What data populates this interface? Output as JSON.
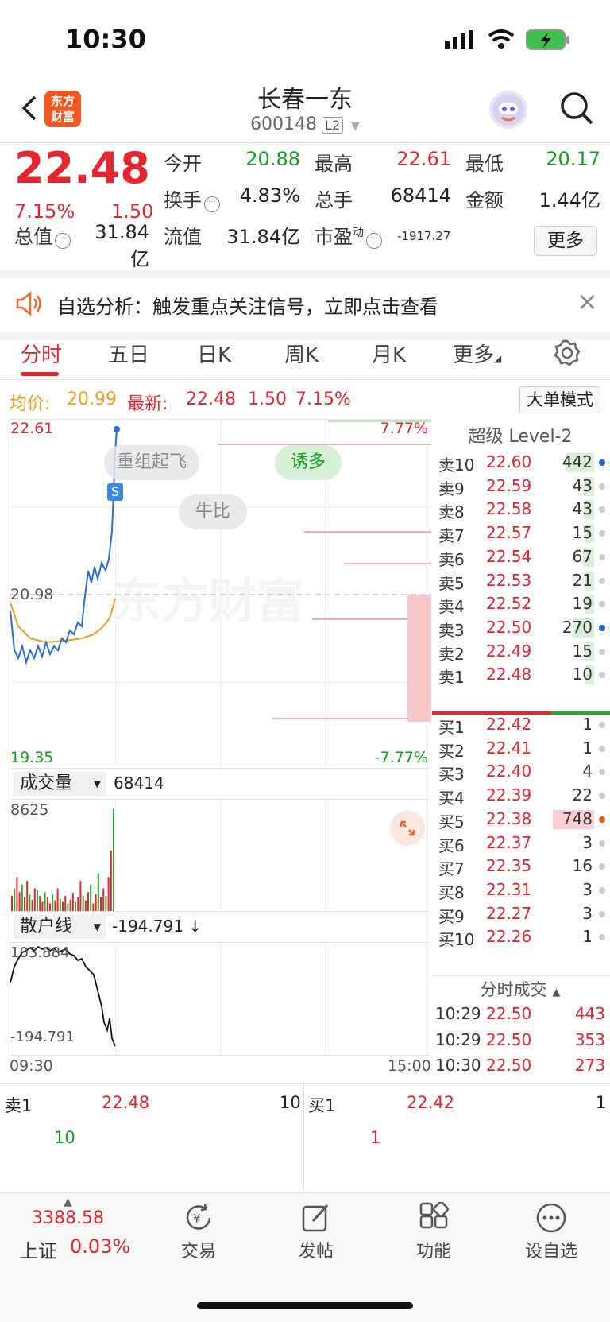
{
  "status": {
    "time": "10:30"
  },
  "header": {
    "title": "长春一东",
    "code": "600148",
    "level": "L2",
    "logo_line1": "东方",
    "logo_line2": "财富"
  },
  "quote": {
    "price": "22.48",
    "pct": "7.15%",
    "change": "1.50",
    "fields": [
      {
        "label": "今开",
        "value": "20.88",
        "color": "green"
      },
      {
        "label": "最高",
        "value": "22.61",
        "color": "red"
      },
      {
        "label": "最低",
        "value": "20.17",
        "color": "green"
      },
      {
        "label": "换手",
        "value": "4.83%",
        "color": "black"
      },
      {
        "label": "总手",
        "value": "68414",
        "color": "black"
      },
      {
        "label": "金额",
        "value": "1.44亿",
        "color": "black"
      },
      {
        "label": "总值",
        "value": "31.84亿",
        "color": "black"
      },
      {
        "label": "流值",
        "value": "31.84亿",
        "color": "black"
      },
      {
        "label": "市盈",
        "sup": "动",
        "value": "-1917.27",
        "color": "black"
      }
    ],
    "more": "更多"
  },
  "banner": {
    "text": "自选分析：触发重点关注信号，立即点击查看",
    "close": "×"
  },
  "tabs": [
    "分时",
    "五日",
    "日K",
    "周K",
    "月K",
    "更多"
  ],
  "avg": {
    "label": "均价:",
    "value": "20.99",
    "latest_label": "最新:",
    "latest": "22.48",
    "chg": "1.50",
    "pct": "7.15%",
    "mode": "大单模式"
  },
  "chart": {
    "hi": "22.61",
    "mid": "20.98",
    "lo": "19.35",
    "pct_hi": "7.77%",
    "pct_lo": "-7.77%",
    "watermark": "东方财富",
    "chips": [
      "重组起飞",
      "诱多",
      "牛比"
    ],
    "marker": "S",
    "start": "09:30",
    "end": "15:00"
  },
  "volume": {
    "selector": "成交量",
    "total": "68414",
    "max": "8625"
  },
  "retail": {
    "selector": "散户线",
    "value": "-194.791 ↓",
    "top": "103.884",
    "bottom": "-194.791"
  },
  "orderbook": {
    "title": "超级 Level-2",
    "asks": [
      {
        "l": "卖10",
        "p": "22.60",
        "v": "442",
        "dot": "#2a62d8",
        "bar": 0.6
      },
      {
        "l": "卖9",
        "p": "22.59",
        "v": "43",
        "dot": "#ccc",
        "bar": 0.08
      },
      {
        "l": "卖8",
        "p": "22.58",
        "v": "43",
        "dot": "#ccc",
        "bar": 0.08
      },
      {
        "l": "卖7",
        "p": "22.57",
        "v": "15",
        "dot": "#ccc",
        "bar": 0.04
      },
      {
        "l": "卖6",
        "p": "22.54",
        "v": "67",
        "dot": "#ccc",
        "bar": 0.1
      },
      {
        "l": "卖5",
        "p": "22.53",
        "v": "21",
        "dot": "#ccc",
        "bar": 0.04
      },
      {
        "l": "卖4",
        "p": "22.52",
        "v": "19",
        "dot": "#ccc",
        "bar": 0.04
      },
      {
        "l": "卖3",
        "p": "22.50",
        "v": "270",
        "dot": "#2a62d8",
        "bar": 0.4
      },
      {
        "l": "卖2",
        "p": "22.49",
        "v": "15",
        "dot": "#ccc",
        "bar": 0.03
      },
      {
        "l": "卖1",
        "p": "22.48",
        "v": "10",
        "dot": "#ccc",
        "bar": 0.02
      }
    ],
    "bids": [
      {
        "l": "买1",
        "p": "22.42",
        "v": "1",
        "dot": "#ccc",
        "bar": 0
      },
      {
        "l": "买2",
        "p": "22.41",
        "v": "1",
        "dot": "#ccc",
        "bar": 0
      },
      {
        "l": "买3",
        "p": "22.40",
        "v": "4",
        "dot": "#ccc",
        "bar": 0
      },
      {
        "l": "买4",
        "p": "22.39",
        "v": "22",
        "dot": "#ccc",
        "bar": 0
      },
      {
        "l": "买5",
        "p": "22.38",
        "v": "748",
        "dot": "#e5581c",
        "bar": 1
      },
      {
        "l": "买6",
        "p": "22.37",
        "v": "3",
        "dot": "#ccc",
        "bar": 0
      },
      {
        "l": "买7",
        "p": "22.35",
        "v": "16",
        "dot": "#ccc",
        "bar": 0
      },
      {
        "l": "买8",
        "p": "22.31",
        "v": "3",
        "dot": "#ccc",
        "bar": 0
      },
      {
        "l": "买9",
        "p": "22.27",
        "v": "3",
        "dot": "#ccc",
        "bar": 0
      },
      {
        "l": "买10",
        "p": "22.26",
        "v": "1",
        "dot": "#ccc",
        "bar": 0
      }
    ],
    "ticks_title": "分时成交",
    "ticks": [
      {
        "t": "10:29",
        "p": "22.50",
        "v": "443"
      },
      {
        "t": "10:29",
        "p": "22.50",
        "v": "353"
      },
      {
        "t": "10:30",
        "p": "22.50",
        "v": "273"
      }
    ]
  },
  "level1": {
    "sell_label": "卖1",
    "sell_price": "22.48",
    "sell_vol": "10",
    "buy_label": "买1",
    "buy_price": "22.42",
    "buy_vol": "1",
    "sell_qty": "10",
    "buy_qty": "1"
  },
  "tabbar": {
    "index_value": "3388.58",
    "index_name": "上证",
    "index_pct": "0.03%",
    "items": [
      "交易",
      "发帖",
      "功能",
      "设自选"
    ]
  }
}
